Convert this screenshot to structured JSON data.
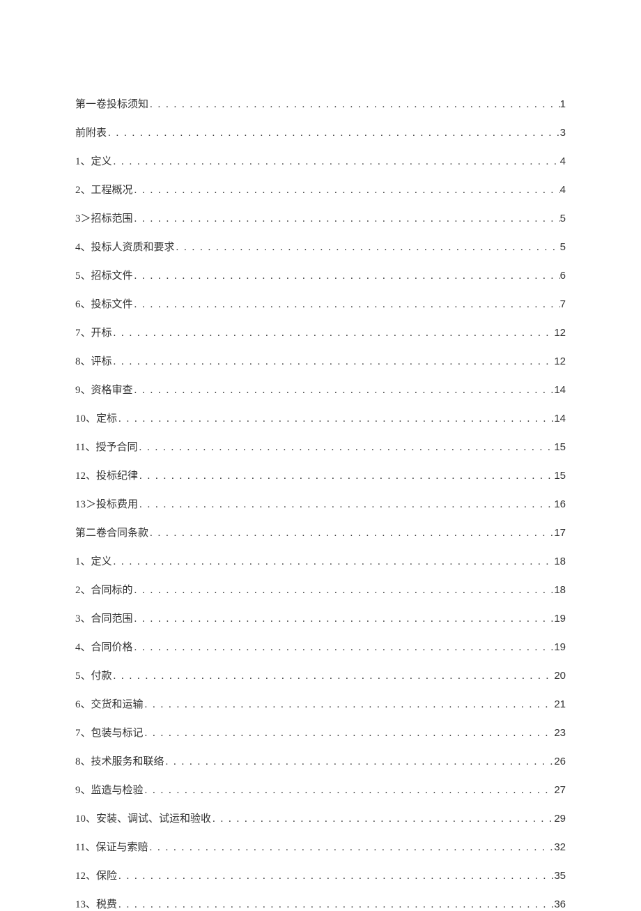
{
  "toc": [
    {
      "label": "第一卷投标须知",
      "page": "1"
    },
    {
      "label": "前附表",
      "page": "3"
    },
    {
      "label": "1、定义",
      "page": "4"
    },
    {
      "label": "2、工程概况",
      "page": "4"
    },
    {
      "label": "3＞招标范围",
      "page": "5"
    },
    {
      "label": "4、投标人资质和要求",
      "page": "5"
    },
    {
      "label": "5、招标文件",
      "page": "6"
    },
    {
      "label": "6、投标文件",
      "page": "7"
    },
    {
      "label": "7、开标",
      "page": "12"
    },
    {
      "label": "8、评标",
      "page": "12"
    },
    {
      "label": "9、资格审查",
      "page": "14"
    },
    {
      "label": "10、定标",
      "page": "14"
    },
    {
      "label": "11、授予合同",
      "page": "15"
    },
    {
      "label": "12、投标纪律",
      "page": "15"
    },
    {
      "label": "13＞投标费用",
      "page": "16"
    },
    {
      "label": "第二卷合同条款",
      "page": "17"
    },
    {
      "label": "1、定义",
      "page": "18"
    },
    {
      "label": "2、合同标的",
      "page": "18"
    },
    {
      "label": "3、合同范围",
      "page": "19"
    },
    {
      "label": "4、合同价格",
      "page": "19"
    },
    {
      "label": "5、付款",
      "page": "20"
    },
    {
      "label": "6、交货和运输",
      "page": "21"
    },
    {
      "label": "7、包装与标记",
      "page": "23"
    },
    {
      "label": "8、技术服务和联络",
      "page": "26"
    },
    {
      "label": "9、监造与检验",
      "page": "27"
    },
    {
      "label": "10、安装、调试、试运和验收",
      "page": "29"
    },
    {
      "label": "11、保证与索赔",
      "page": "32"
    },
    {
      "label": "12、保险",
      "page": "35"
    },
    {
      "label": "13、税费",
      "page": "36"
    }
  ]
}
